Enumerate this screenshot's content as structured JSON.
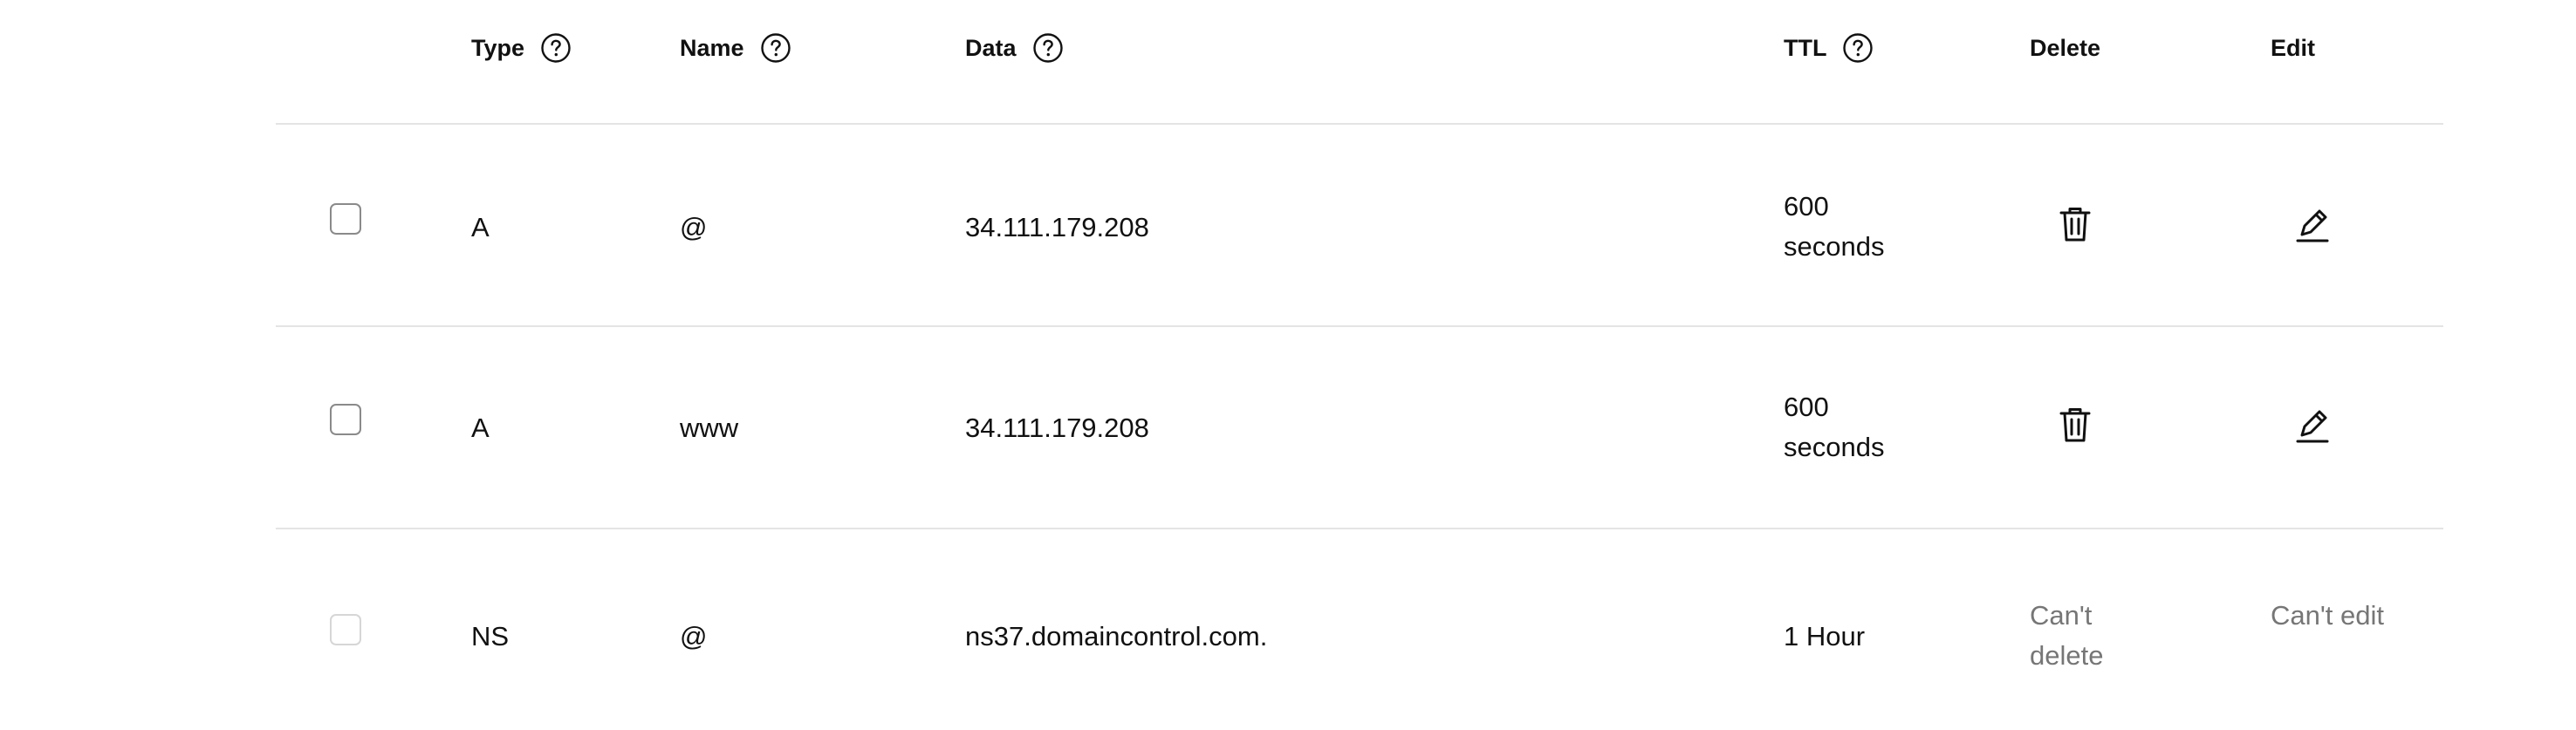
{
  "header": {
    "type_label": "Type",
    "name_label": "Name",
    "data_label": "Data",
    "ttl_label": "TTL",
    "delete_label": "Delete",
    "edit_label": "Edit"
  },
  "records": [
    {
      "type": "A",
      "name": "@",
      "data": "34.111.179.208",
      "ttl": "600 seconds",
      "delete": "trash-icon",
      "edit": "pencil-icon",
      "editable": true
    },
    {
      "type": "A",
      "name": "www",
      "data": "34.111.179.208",
      "ttl": "600 seconds",
      "delete": "trash-icon",
      "edit": "pencil-icon",
      "editable": true
    },
    {
      "type": "NS",
      "name": "@",
      "data": "ns37.domaincontrol.com.",
      "ttl": "1 Hour",
      "delete": "Can't delete",
      "edit": "Can't edit",
      "editable": false
    }
  ],
  "colors": {
    "text": "#111111",
    "muted": "#767676",
    "divider": "#e4e4e4",
    "checkbox_border": "#8a8a8a"
  }
}
